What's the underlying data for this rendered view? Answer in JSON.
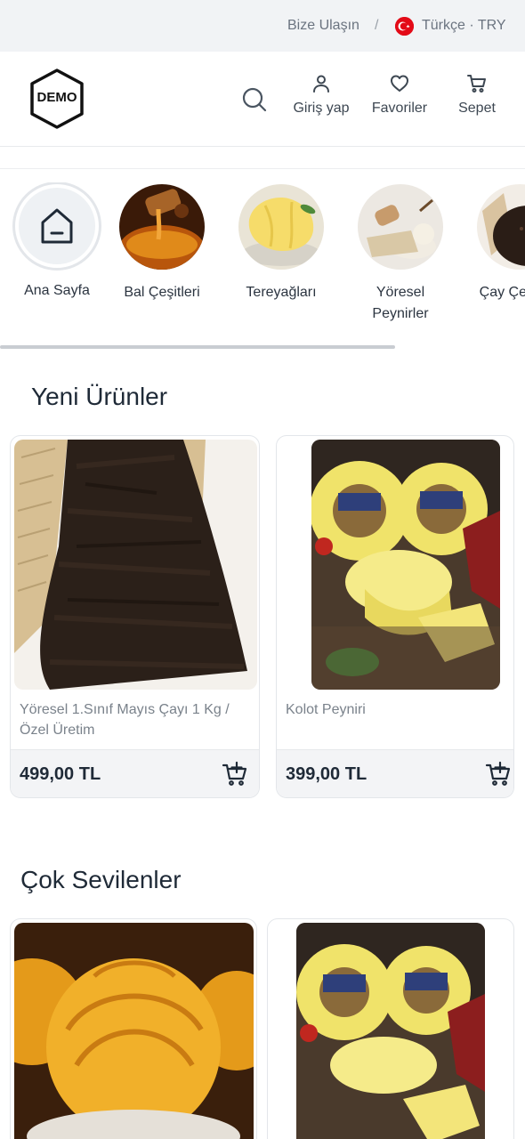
{
  "topbar": {
    "contact_label": "Bize Ulaşın",
    "separator": "/",
    "language_currency": "Türkçe · TRY"
  },
  "header": {
    "logo_text": "DEMO",
    "nav": {
      "login_label": "Giriş yap",
      "favorites_label": "Favoriler",
      "cart_label": "Sepet"
    }
  },
  "categories": [
    {
      "label": "Ana Sayfa",
      "icon": "home-icon"
    },
    {
      "label": "Bal Çeşitleri",
      "icon": "honey-image"
    },
    {
      "label": "Tereyağları",
      "icon": "butter-image"
    },
    {
      "label": "Yöresel Peynirler",
      "icon": "cheese-image"
    },
    {
      "label": "Çay Çeşitleri",
      "icon": "tea-image"
    }
  ],
  "sections": {
    "new_products": {
      "title": "Yeni Ürünler",
      "products": [
        {
          "name": "Yöresel 1.Sınıf Mayıs Çayı 1 Kg / Özel Üretim",
          "price": "499,00 TL"
        },
        {
          "name": "Kolot Peyniri",
          "price": "399,00 TL"
        }
      ]
    },
    "most_loved": {
      "title": "Çok Sevilenler"
    }
  },
  "colors": {
    "topbar_bg": "#f1f3f5",
    "text_dark": "#1f2a37",
    "text_muted": "#7a828b",
    "card_footer_bg": "#f3f4f6",
    "flag_red": "#e30a17"
  }
}
